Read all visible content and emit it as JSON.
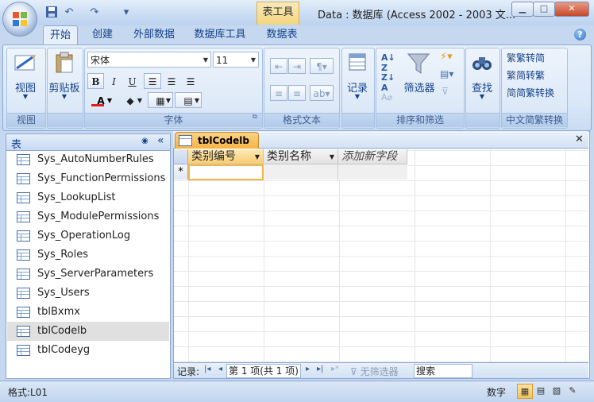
{
  "window": {
    "context_tab": "表工具",
    "title": "Data : 数据库 (Access 2002 - 2003 文...",
    "minimize": "▁",
    "maximize": "□",
    "close": "✕"
  },
  "qat": {
    "save_icon": "save-icon",
    "undo": "↶",
    "redo": "↷",
    "customize": "▾"
  },
  "tabs": [
    "开始",
    "创建",
    "外部数据",
    "数据库工具",
    "数据表"
  ],
  "help": "?",
  "ribbon": {
    "view": {
      "label": "视图",
      "group": "视图"
    },
    "clipboard": {
      "label": "剪贴板"
    },
    "font": {
      "family": "宋体",
      "size": "11",
      "group": "字体",
      "bold": "B",
      "italic": "I",
      "underline": "U"
    },
    "rich_text": {
      "group": "格式文本"
    },
    "records": {
      "label": "记录"
    },
    "sort_filter": {
      "filter": "筛选器",
      "group": "排序和筛选"
    },
    "find": {
      "label": "查找"
    },
    "chinese": {
      "to_traditional": "繁转简",
      "to_simplified": "简转繁",
      "convert": "简繁转换",
      "group": "中文简繁转换"
    }
  },
  "nav": {
    "title": "表",
    "collapse": "«",
    "items": [
      "Sys_AutoNumberRules",
      "Sys_FunctionPermissions",
      "Sys_LookupList",
      "Sys_ModulePermissions",
      "Sys_OperationLog",
      "Sys_Roles",
      "Sys_ServerParameters",
      "Sys_Users",
      "tblBxmx",
      "tblCodelb",
      "tblCodeyg"
    ],
    "selected_index": 9
  },
  "document": {
    "tab_title": "tblCodelb",
    "close": "✕",
    "columns": [
      "类别编号",
      "类别名称",
      "添加新字段"
    ],
    "new_row_marker": "*"
  },
  "record_nav": {
    "label": "记录:",
    "first": "|◂",
    "prev": "◂",
    "position": "第 1 项(共 1 项)",
    "next": "▸",
    "last": "▸|",
    "new": "▸*",
    "filter_status": "无筛选器",
    "search": "搜索"
  },
  "statusbar": {
    "left": "格式:L01",
    "mode": "数字"
  }
}
